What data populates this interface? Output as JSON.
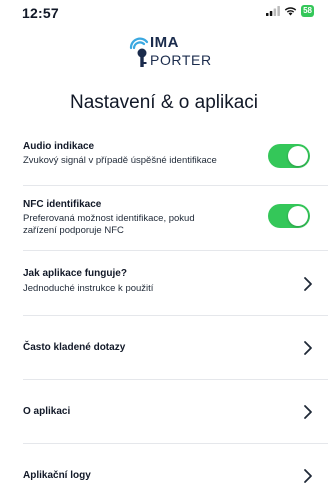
{
  "status_bar": {
    "time": "12:57",
    "battery": "58",
    "icons": [
      "signal-icon",
      "wifi-icon",
      "battery-icon"
    ]
  },
  "logo": {
    "line1": "IMA",
    "line2": "PORTER",
    "colors": {
      "mark": "#3aa8e0",
      "text": "#1a2b4c"
    }
  },
  "title": "Nastavení & o aplikaci",
  "settings": {
    "audio": {
      "label": "Audio indikace",
      "description": "Zvukový signál v případě úspěšné identifikace",
      "enabled": true
    },
    "nfc": {
      "label": "NFC identifikace",
      "description": "Preferovaná možnost identifikace, pokud zařízení podporuje NFC",
      "enabled": true
    }
  },
  "menu": {
    "how_it_works": {
      "label": "Jak aplikace funguje?",
      "description": "Jednoduché instrukce k použití"
    },
    "faq": {
      "label": "Často kladené dotazy"
    },
    "about": {
      "label": "O aplikaci"
    },
    "logs": {
      "label": "Aplikační logy"
    }
  },
  "colors": {
    "toggle_on": "#34c759",
    "divider": "#e5e7eb",
    "text": "#111827"
  }
}
